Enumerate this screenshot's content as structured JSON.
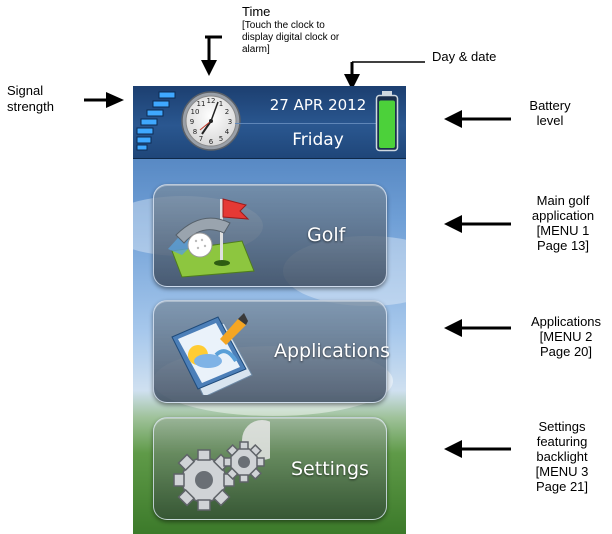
{
  "annotations": {
    "time_title": "Time",
    "time_note_1": "[Touch the clock to",
    "time_note_2": "display digital clock or",
    "time_note_3": "alarm]",
    "day_date": "Day & date",
    "signal_1": "Signal",
    "signal_2": "strength",
    "battery_1": "Battery",
    "battery_2": "level",
    "golf_1": "Main golf",
    "golf_2": "application",
    "golf_3": "[MENU 1",
    "golf_4": "Page 13]",
    "apps_1": "Applications",
    "apps_2": "[MENU 2",
    "apps_3": "Page 20]",
    "settings_1": "Settings",
    "settings_2": "featuring",
    "settings_3": "backlight",
    "settings_4": "[MENU 3",
    "settings_5": "Page 21]"
  },
  "status_bar": {
    "date": "27 APR 2012",
    "day": "Friday",
    "battery_level": 0.95
  },
  "menu": {
    "golf_label": "Golf",
    "applications_label": "Applications",
    "settings_label": "Settings"
  },
  "icons": {
    "signal": "signal-strength-icon",
    "clock": "analog-clock-icon",
    "battery": "battery-icon",
    "golf": "golf-ball-flag-icon",
    "applications": "applications-icon",
    "settings": "gears-icon"
  },
  "colors": {
    "status_bar": "#2a5790",
    "battery_fill": "#4cd13a",
    "button_border": "#e6f0ff"
  }
}
